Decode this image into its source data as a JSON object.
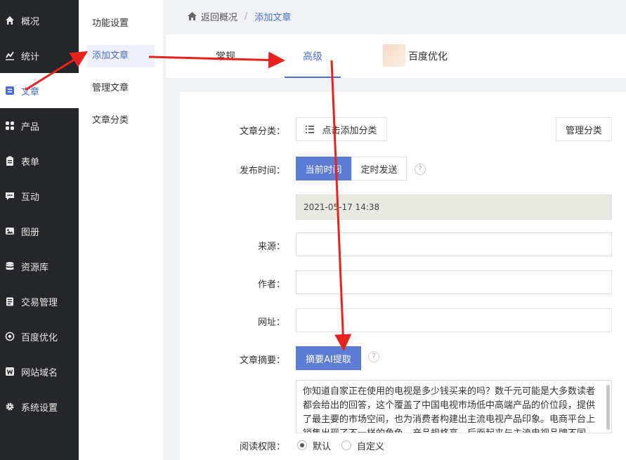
{
  "sidebar": {
    "items": [
      {
        "label": "概况",
        "icon": "home-icon"
      },
      {
        "label": "统计",
        "icon": "chart-icon"
      },
      {
        "label": "文章",
        "icon": "article-icon"
      },
      {
        "label": "产品",
        "icon": "grid-icon"
      },
      {
        "label": "表单",
        "icon": "clipboard-icon"
      },
      {
        "label": "互动",
        "icon": "chat-icon"
      },
      {
        "label": "图册",
        "icon": "image-icon"
      },
      {
        "label": "资源库",
        "icon": "database-icon"
      },
      {
        "label": "交易管理",
        "icon": "receipt-icon"
      },
      {
        "label": "百度优化",
        "icon": "target-icon"
      },
      {
        "label": "网站域名",
        "icon": "w-icon"
      },
      {
        "label": "系统设置",
        "icon": "gear-icon"
      }
    ]
  },
  "submenu": {
    "items": [
      "功能设置",
      "添加文章",
      "管理文章",
      "文章分类"
    ]
  },
  "breadcrumb": {
    "home": "返回概况",
    "separator": "/",
    "current": "添加文章"
  },
  "tabs": [
    "常规",
    "高级",
    "百度优化"
  ],
  "form": {
    "category_label": "文章分类：",
    "category_button": "点击添加分类",
    "manage_category_button": "管理分类",
    "publish_label": "发布时间：",
    "now_button": "当前时间",
    "scheduled_button": "定时发送",
    "help_glyph": "?",
    "publish_datetime": "2021-05-17 14:38",
    "source_label": "来源：",
    "author_label": "作者：",
    "url_label": "网址：",
    "summary_label": "文章摘要：",
    "summary_ai_button": "摘要AI提取",
    "summary_text": "你知道自家正在使用的电视是多少钱买来的吗？数千元可能是大多数读者都会给出的回答，这个覆盖了中国电视市场低中高端产品的价位段，提供了最主要的市场空间，也为消费者构建出主流电视产品印象。电商平台上销售出现了不一样的角色，产品规格高，后面起来与主流电视品牌不同，却",
    "permission_label": "阅读权限：",
    "permission_options": [
      "默认",
      "自定义"
    ]
  },
  "colors": {
    "accent": "#4a6fd1",
    "primary_button": "#5b7bd5",
    "sidebar_bg": "#252629",
    "annotation_arrow": "#e8231f"
  }
}
